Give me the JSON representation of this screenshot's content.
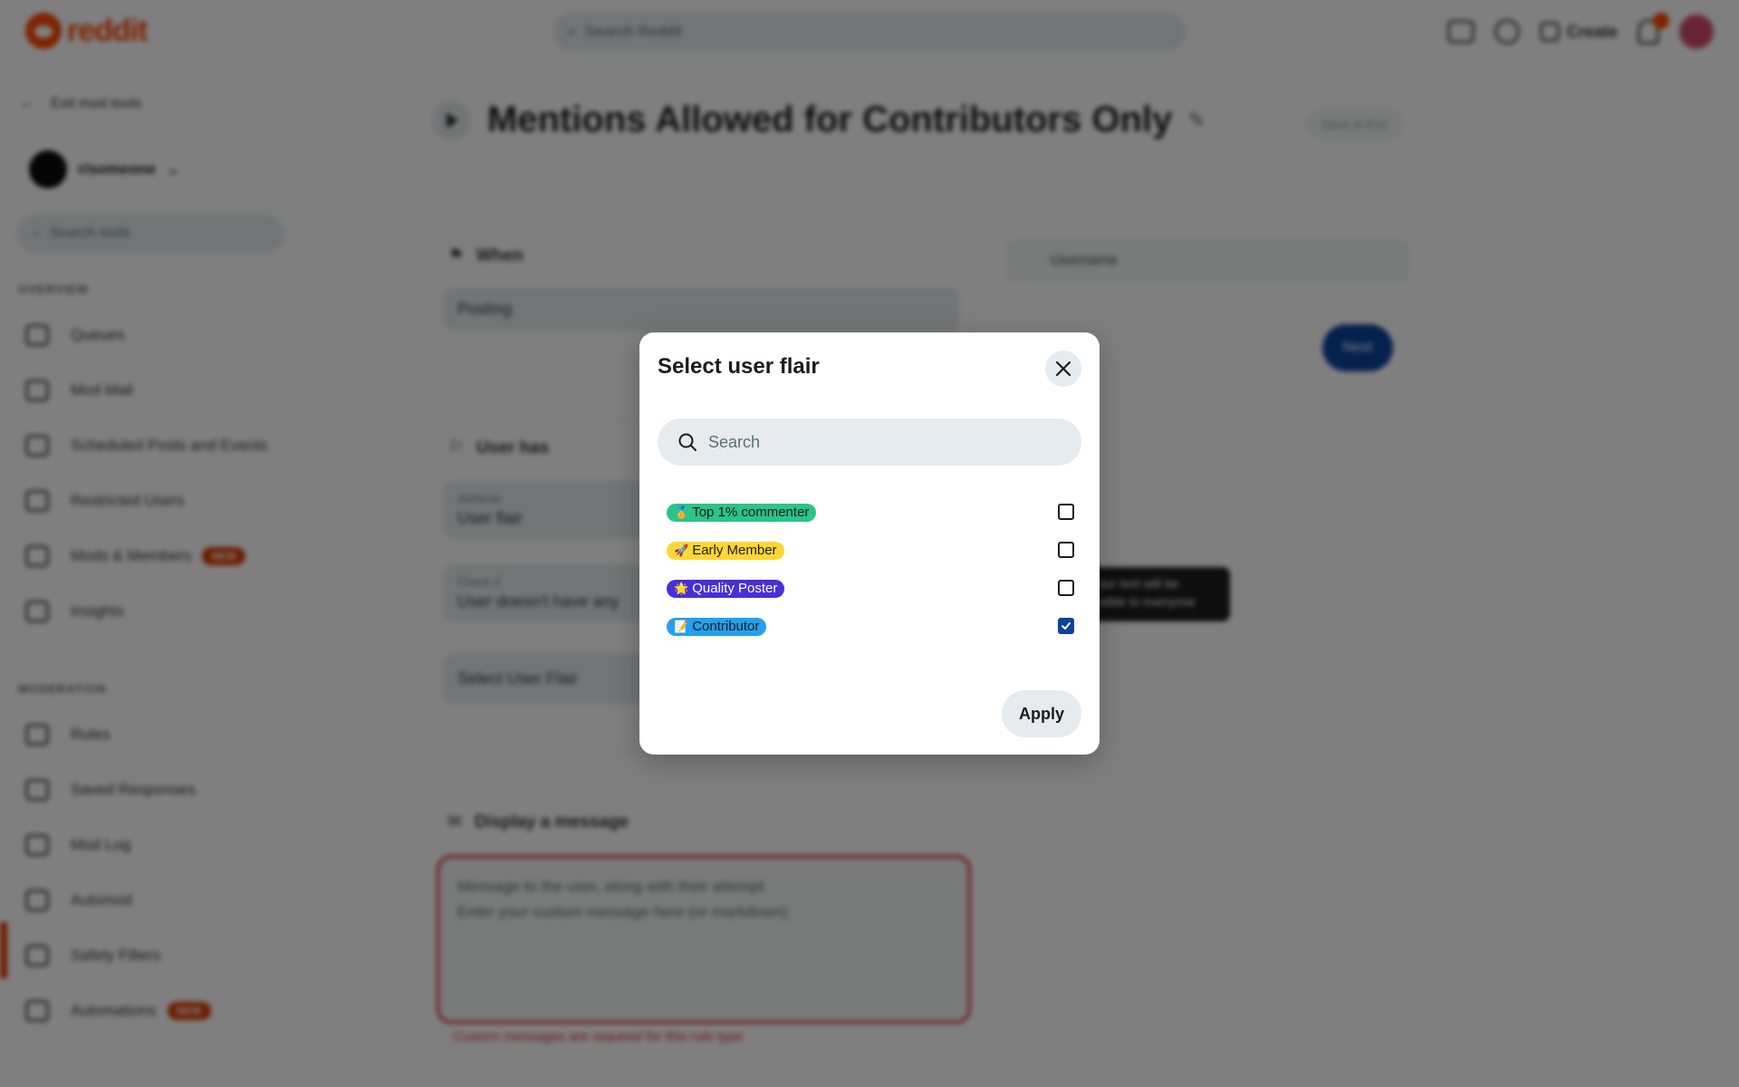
{
  "app": {
    "logo_text": "reddit",
    "search_placeholder": "Search Reddit",
    "create_label": "Create"
  },
  "sidebar": {
    "back_label": "Exit mod tools",
    "subreddit_name": "r/someone",
    "search_placeholder": "Search tools",
    "overview_heading": "OVERVIEW",
    "overview_items": [
      {
        "label": "Queues"
      },
      {
        "label": "Mod Mail"
      },
      {
        "label": "Scheduled Posts and Events"
      },
      {
        "label": "Restricted Users"
      },
      {
        "label": "Mods & Members",
        "badge": "NEW"
      },
      {
        "label": "Insights"
      }
    ],
    "moderation_heading": "MODERATION",
    "moderation_items": [
      {
        "label": "Rules"
      },
      {
        "label": "Saved Responses"
      },
      {
        "label": "Mod Log"
      },
      {
        "label": "Automod"
      },
      {
        "label": "Safety Filters"
      },
      {
        "label": "Automations",
        "badge": "NEW"
      }
    ]
  },
  "main": {
    "title": "Mentions Allowed for Contributors Only",
    "save_label": "Save & Exit",
    "when_label": "When",
    "when_value": "Posting",
    "user_has_label": "User has",
    "user_flair_small": "Attribute",
    "user_flair_value": "User flair",
    "condition_small": "Check if",
    "condition_value": "User doesn't have any",
    "select_flair_placeholder": "Select User Flair",
    "display_message_label": "Display a message",
    "message_hint": "Message to the user, along with their attempt",
    "message_placeholder": "Enter your custom message here (or markdown)",
    "error_text": "Custom messages are required for this rule type",
    "preview_name": "Username",
    "preview_button": "Next",
    "tooltip_text": "Your text will be visible to everyone"
  },
  "modal": {
    "title": "Select user flair",
    "search_placeholder": "Search",
    "apply_label": "Apply",
    "flairs": [
      {
        "emoji": "🏅",
        "label": "Top 1% commenter",
        "bg": "#2bc48a",
        "fg": "#1c1c1c",
        "checked": false
      },
      {
        "emoji": "🚀",
        "label": "Early Member",
        "bg": "#ffd635",
        "fg": "#1c1c1c",
        "checked": false
      },
      {
        "emoji": "🌟",
        "label": "Quality Poster",
        "bg": "#4a2ed8",
        "fg": "#ffffff",
        "checked": false
      },
      {
        "emoji": "📝",
        "label": "Contributor",
        "bg": "#24a0ed",
        "fg": "#1c1c1c",
        "checked": true
      }
    ]
  },
  "colors": {
    "accent": "#ff4500",
    "checkbox_checked": "#0a449b",
    "error": "#e0242a"
  }
}
